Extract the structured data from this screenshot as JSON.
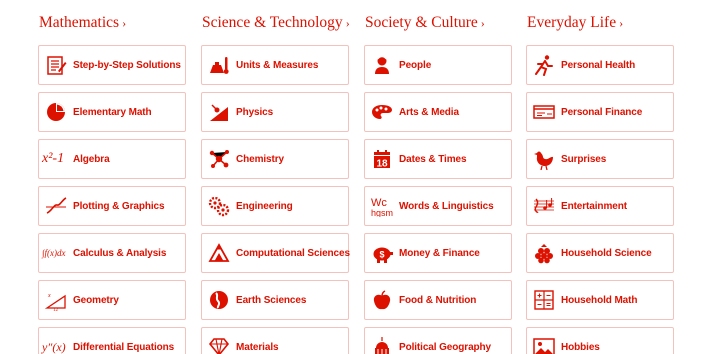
{
  "accent_color": "#dd1100",
  "border_color": "#f4c2bd",
  "columns": [
    {
      "title": "Mathematics",
      "chevron": "›",
      "items": [
        {
          "label": "Step-by-Step Solutions",
          "icon": "steps-icon"
        },
        {
          "label": "Elementary Math",
          "icon": "pie-chart-icon"
        },
        {
          "label": "Algebra",
          "icon": "algebra-icon",
          "icon_text": "x²-1"
        },
        {
          "label": "Plotting & Graphics",
          "icon": "plot-curve-icon"
        },
        {
          "label": "Calculus & Analysis",
          "icon": "integral-icon",
          "icon_text": "∫f(x)dx"
        },
        {
          "label": "Geometry",
          "icon": "triangle-geometry-icon"
        },
        {
          "label": "Differential Equations",
          "icon": "derivative-icon",
          "icon_text": "y″(x)"
        }
      ]
    },
    {
      "title": "Science & Technology",
      "chevron": "›",
      "items": [
        {
          "label": "Units & Measures",
          "icon": "scale-thermometer-icon"
        },
        {
          "label": "Physics",
          "icon": "physics-icon"
        },
        {
          "label": "Chemistry",
          "icon": "molecule-icon"
        },
        {
          "label": "Engineering",
          "icon": "gears-icon"
        },
        {
          "label": "Computational Sciences",
          "icon": "triangle-dots-icon"
        },
        {
          "label": "Earth Sciences",
          "icon": "globe-icon"
        },
        {
          "label": "Materials",
          "icon": "diamond-icon"
        }
      ]
    },
    {
      "title": "Society & Culture",
      "chevron": "›",
      "items": [
        {
          "label": "People",
          "icon": "person-bust-icon"
        },
        {
          "label": "Arts & Media",
          "icon": "palette-icon"
        },
        {
          "label": "Dates & Times",
          "icon": "calendar-icon",
          "icon_text": "18"
        },
        {
          "label": "Words & Linguistics",
          "icon": "letters-icon",
          "icon_text": "Wc hgsm"
        },
        {
          "label": "Money & Finance",
          "icon": "piggy-bank-icon"
        },
        {
          "label": "Food & Nutrition",
          "icon": "apple-icon"
        },
        {
          "label": "Political Geography",
          "icon": "capitol-icon"
        }
      ]
    },
    {
      "title": "Everyday Life",
      "chevron": "›",
      "items": [
        {
          "label": "Personal Health",
          "icon": "runner-icon"
        },
        {
          "label": "Personal Finance",
          "icon": "check-icon"
        },
        {
          "label": "Surprises",
          "icon": "chicken-icon"
        },
        {
          "label": "Entertainment",
          "icon": "music-staff-icon"
        },
        {
          "label": "Household Science",
          "icon": "raspberry-icon"
        },
        {
          "label": "Household Math",
          "icon": "calculator-icon"
        },
        {
          "label": "Hobbies",
          "icon": "photo-icon"
        }
      ]
    }
  ]
}
